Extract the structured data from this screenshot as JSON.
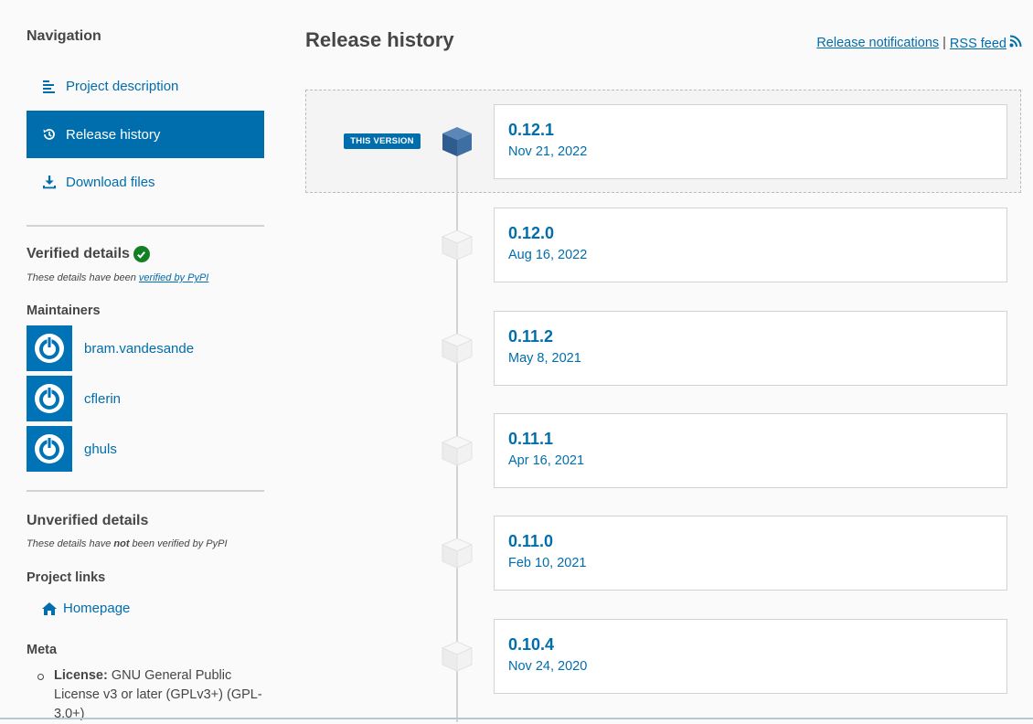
{
  "sidebar": {
    "nav_heading": "Navigation",
    "nav_items": [
      {
        "label": "Project description",
        "icon": "align-left-icon",
        "active": false
      },
      {
        "label": "Release history",
        "icon": "history-icon",
        "active": true
      },
      {
        "label": "Download files",
        "icon": "download-icon",
        "active": false
      }
    ],
    "verified": {
      "heading": "Verified details",
      "note_prefix": "These details have been ",
      "note_link": "verified by PyPI"
    },
    "maintainers": {
      "heading": "Maintainers",
      "users": [
        "bram.vandesande",
        "cflerin",
        "ghuls"
      ]
    },
    "unverified": {
      "heading": "Unverified details",
      "note_prefix": "These details have ",
      "note_bold": "not",
      "note_suffix": " been verified by PyPI"
    },
    "project_links": {
      "heading": "Project links",
      "homepage": "Homepage"
    },
    "meta": {
      "heading": "Meta",
      "license_label": "License:",
      "license_value": " GNU General Public License v3 or later (GPLv3+) (GPL-3.0+)"
    }
  },
  "main": {
    "title": "Release history",
    "links": {
      "notifications": "Release notifications",
      "separator": "|",
      "rss": "RSS feed"
    },
    "this_version_badge": "THIS VERSION",
    "releases": [
      {
        "version": "0.12.1",
        "date": "Nov 21, 2022",
        "current": true
      },
      {
        "version": "0.12.0",
        "date": "Aug 16, 2022",
        "current": false
      },
      {
        "version": "0.11.2",
        "date": "May 8, 2021",
        "current": false
      },
      {
        "version": "0.11.1",
        "date": "Apr 16, 2021",
        "current": false
      },
      {
        "version": "0.11.0",
        "date": "Feb 10, 2021",
        "current": false
      },
      {
        "version": "0.10.4",
        "date": "Nov 24, 2020",
        "current": false
      }
    ]
  },
  "colors": {
    "accent": "#006dad",
    "verified_green": "#148024"
  }
}
